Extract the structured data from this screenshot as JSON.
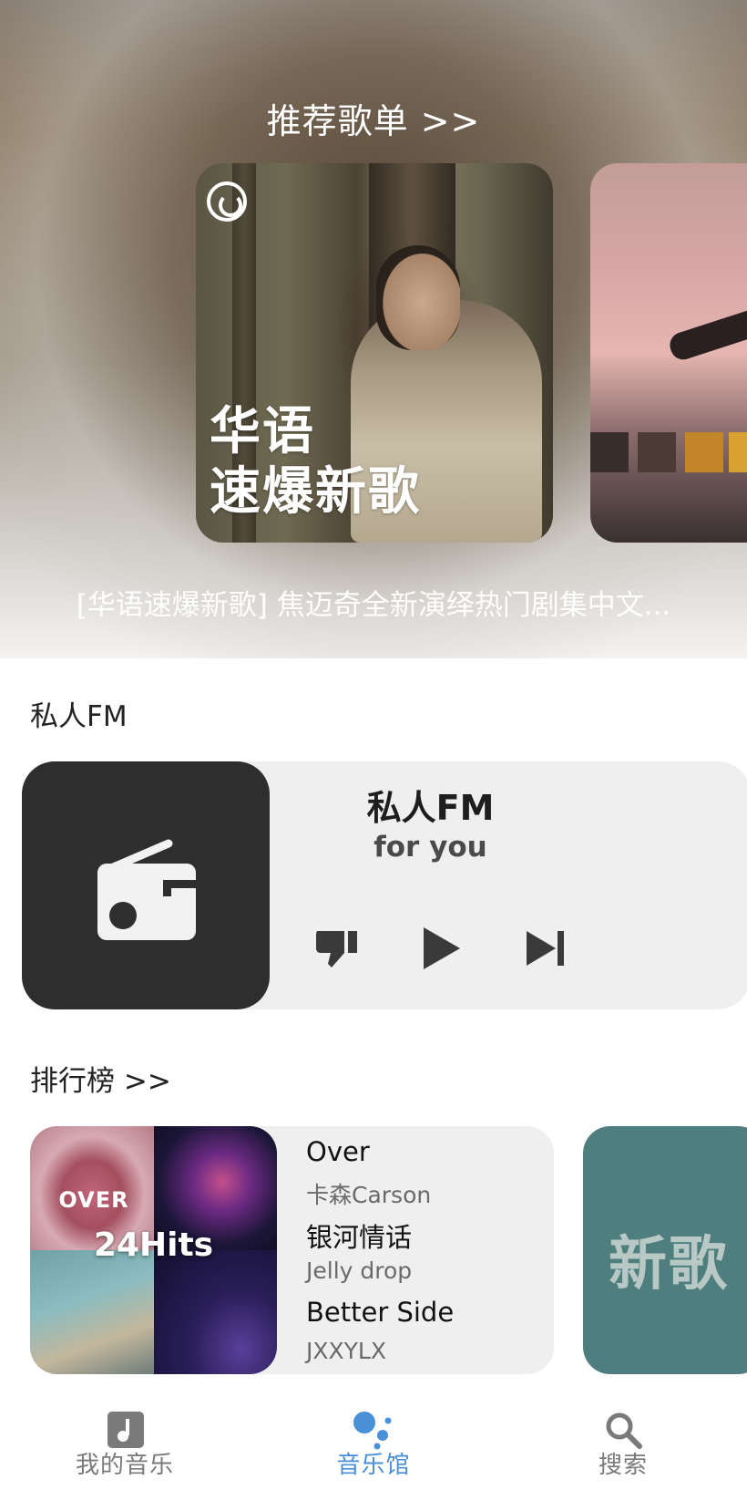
{
  "hero": {
    "title": "推荐歌单 >>",
    "cover_text_line1": "华语",
    "cover_text_line2": "速爆新歌",
    "subtitle": "[华语速爆新歌] 焦迈奇全新演绎热门剧集中文..."
  },
  "fm": {
    "section_title": "私人FM",
    "card_title": "私人FM",
    "card_subtitle": "for you",
    "icons": [
      "radio-icon",
      "thumbs-down-icon",
      "play-icon",
      "skip-next-icon"
    ]
  },
  "charts": {
    "section_title": "排行榜 >>",
    "card_label": "24Hits",
    "cover_text": "OVER",
    "songs": [
      {
        "title": "Over",
        "artist": "卡森Carson"
      },
      {
        "title": "银河情话",
        "artist": "Jelly drop"
      },
      {
        "title": "Better Side",
        "artist": "JXXYLX"
      }
    ],
    "side_card_text": "新歌"
  },
  "nav": {
    "items": [
      {
        "label": "我的音乐",
        "icon": "music-note-icon",
        "active": false
      },
      {
        "label": "音乐馆",
        "icon": "dots-icon",
        "active": true
      },
      {
        "label": "搜索",
        "icon": "search-icon",
        "active": false
      }
    ],
    "active_color": "#4a90d9",
    "inactive_color": "#7a7a7a"
  },
  "colors": {
    "fm_art_bg": "#2e2e2e",
    "card_bg": "#efefef",
    "chart_side_bg": "#4e7e7e"
  }
}
